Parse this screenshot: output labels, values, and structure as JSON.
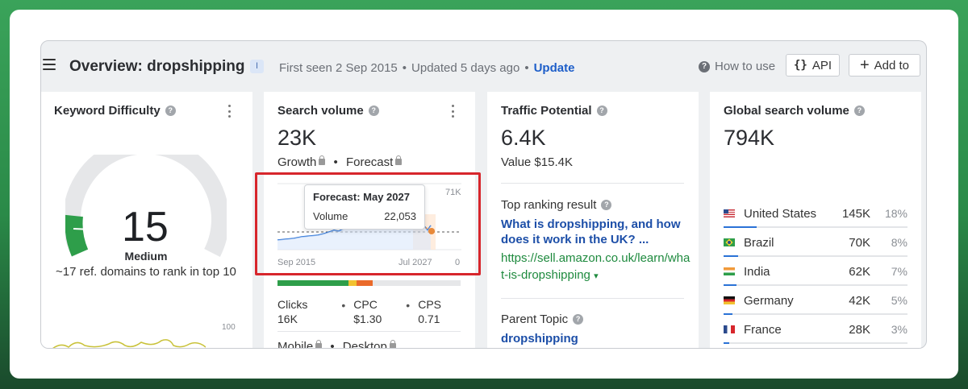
{
  "header": {
    "title": "Overview: dropshipping",
    "badge": "I",
    "first_seen": "First seen 2 Sep 2015",
    "updated": "Updated 5 days ago",
    "update_link": "Update",
    "how_to_use": "How to use",
    "api_label": "API",
    "add_to_label": "Add to"
  },
  "keyword_difficulty": {
    "title": "Keyword Difficulty",
    "score": "15",
    "level": "Medium",
    "note": "~17 ref. domains to rank in top 10",
    "axis_max": "100",
    "gauge_fraction": 0.15
  },
  "search_volume": {
    "title": "Search volume",
    "value": "23K",
    "growth_label": "Growth",
    "forecast_label": "Forecast",
    "chart_ymax": "71K",
    "chart_ymin": "0",
    "chart_xstart": "Sep 2015",
    "chart_xend": "Jul 2027",
    "tooltip_title": "Forecast: May 2027",
    "tooltip_metric": "Volume",
    "tooltip_value": "22,053",
    "clicks_label": "Clicks",
    "clicks_value": "16K",
    "cpc_label": "CPC",
    "cpc_value": "$1.30",
    "cps_label": "CPS",
    "cps_value": "0.71",
    "mobile_label": "Mobile",
    "desktop_label": "Desktop"
  },
  "traffic_potential": {
    "title": "Traffic Potential",
    "value": "6.4K",
    "value_text": "Value $15.4K",
    "top_ranking_label": "Top ranking result",
    "top_ranking_title": "What is dropshipping, and how does it work in the UK? ...",
    "top_ranking_url": "https://sell.amazon.co.uk/learn/what-is-dropshipping",
    "top_ranking_url_arrow": "▾",
    "parent_topic_label": "Parent Topic",
    "parent_topic": "dropshipping"
  },
  "global_volume": {
    "title": "Global search volume",
    "value": "794K",
    "countries": [
      {
        "name": "United States",
        "value": "145K",
        "pct": "18%",
        "share": 0.18
      },
      {
        "name": "Brazil",
        "value": "70K",
        "pct": "8%",
        "share": 0.08
      },
      {
        "name": "India",
        "value": "62K",
        "pct": "7%",
        "share": 0.07
      },
      {
        "name": "Germany",
        "value": "42K",
        "pct": "5%",
        "share": 0.05
      },
      {
        "name": "France",
        "value": "28K",
        "pct": "3%",
        "share": 0.03
      }
    ]
  },
  "colors": {
    "accent_blue": "#1d5ec9",
    "gauge_green": "#2e9e4a",
    "highlight_red": "#d7262c",
    "url_green": "#1e8a3e"
  },
  "icons": {
    "menu": "hamburger-icon",
    "help": "question-icon",
    "api": "braces-icon",
    "add": "plus-icon",
    "lock": "lock-icon"
  }
}
